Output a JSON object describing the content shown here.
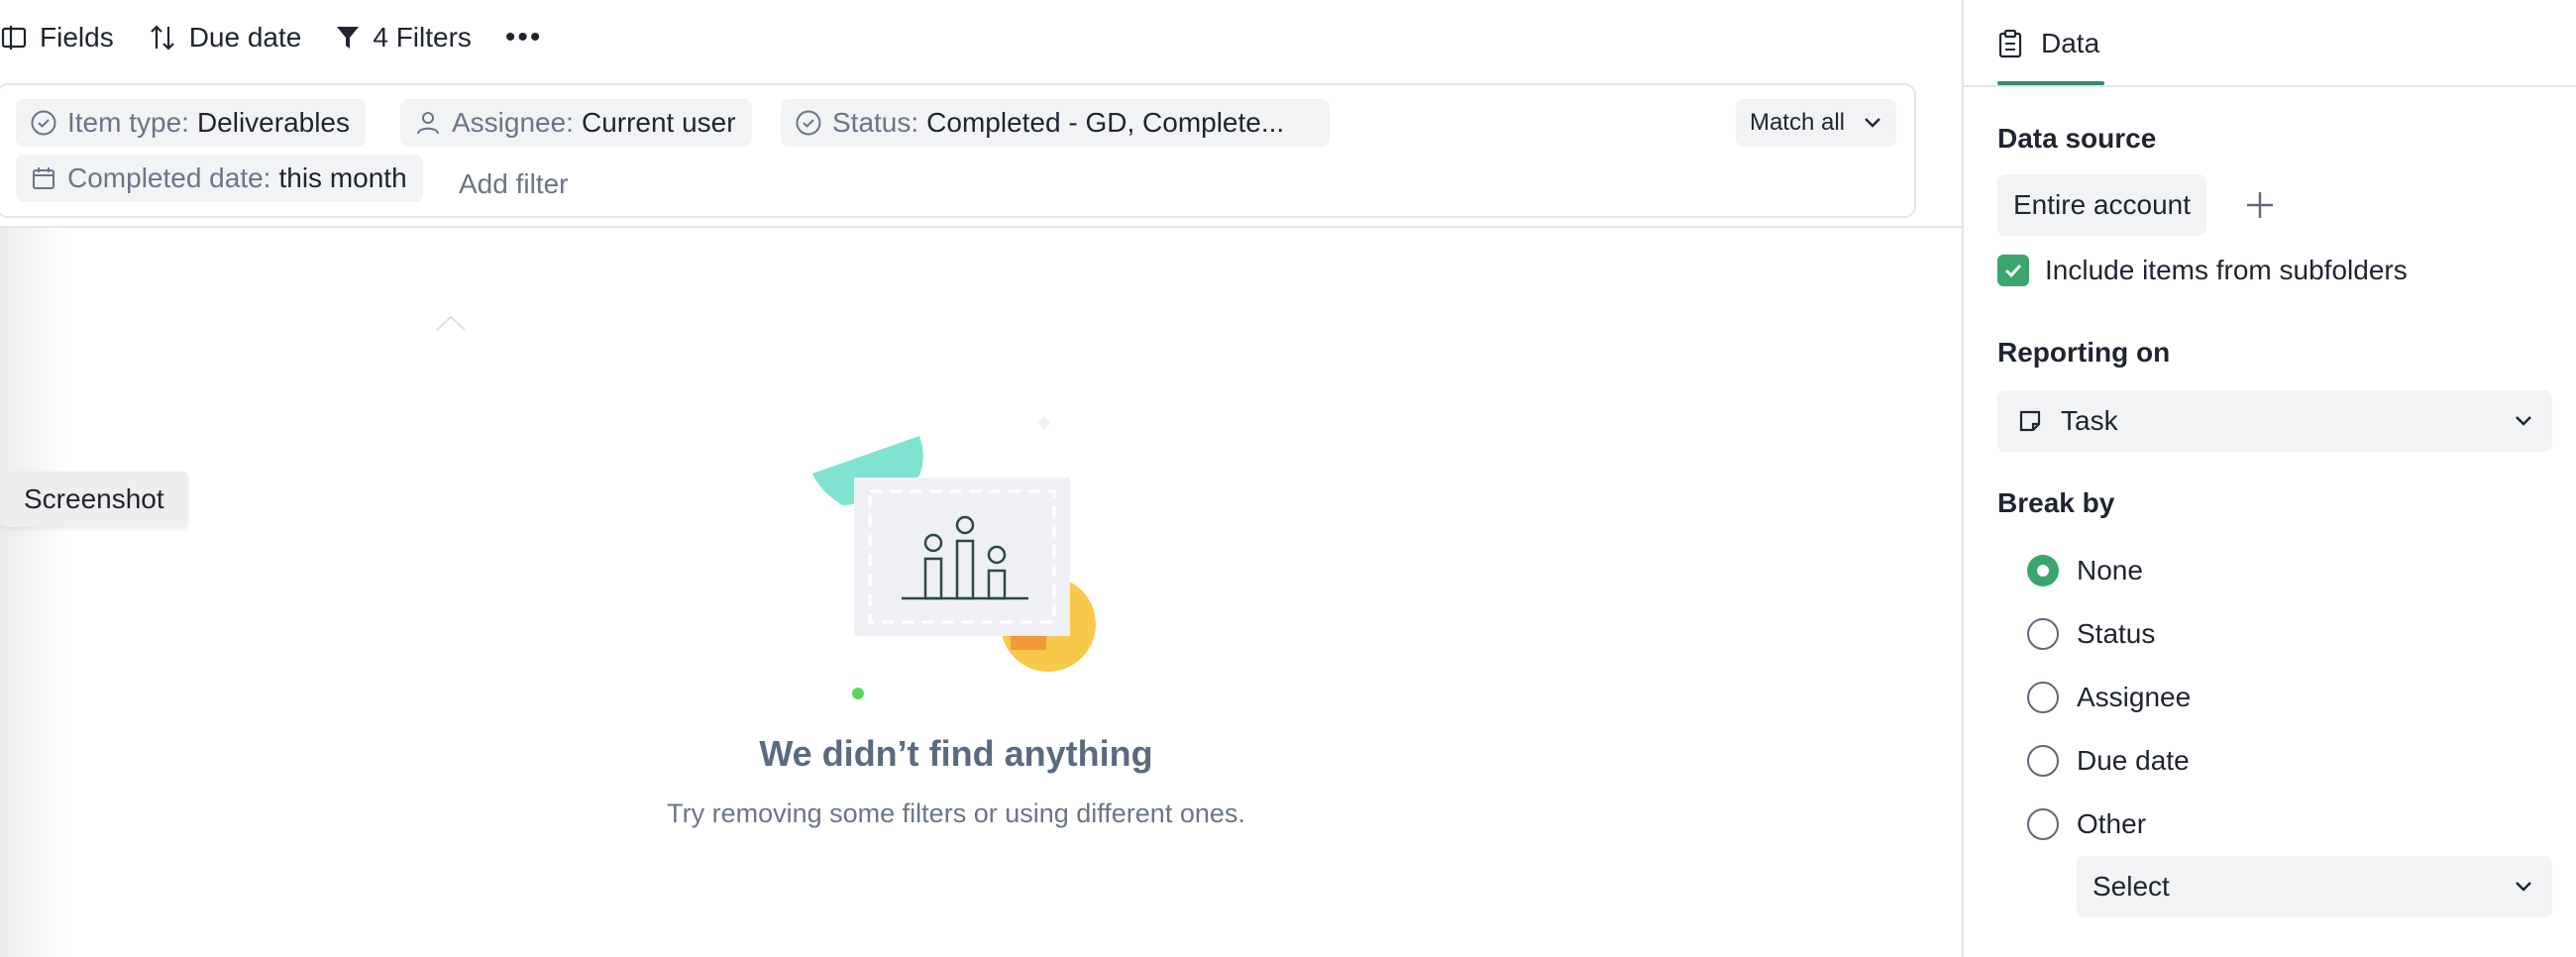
{
  "toolbar": {
    "fields_label": "Fields",
    "due_date_label": "Due date",
    "filters_label": "4 Filters",
    "more_label": "•••"
  },
  "filters": {
    "chips": [
      {
        "key": "Item type:",
        "value": "Deliverables",
        "icon": "check-circle-icon"
      },
      {
        "key": "Assignee:",
        "value": "Current user",
        "icon": "person-icon"
      },
      {
        "key": "Status:",
        "value": "Completed - GD, Complete...",
        "icon": "check-circle-icon"
      },
      {
        "key": "Completed date:",
        "value": "this month",
        "icon": "calendar-icon"
      }
    ],
    "match_label": "Match all",
    "add_filter_label": "Add filter"
  },
  "tooltip": {
    "label": "Screenshot"
  },
  "empty_state": {
    "title": "We didn’t find anything",
    "subtitle": "Try removing some filters or using different ones."
  },
  "panel": {
    "tab_label": "Data",
    "data_source": {
      "heading": "Data source",
      "chip": "Entire account",
      "include_subfolders": "Include items from subfolders",
      "include_subfolders_checked": true
    },
    "reporting_on": {
      "heading": "Reporting on",
      "value": "Task"
    },
    "break_by": {
      "heading": "Break by",
      "options": [
        {
          "label": "None",
          "selected": true
        },
        {
          "label": "Status",
          "selected": false
        },
        {
          "label": "Assignee",
          "selected": false
        },
        {
          "label": "Due date",
          "selected": false
        },
        {
          "label": "Other",
          "selected": false
        }
      ],
      "other_select": "Select"
    }
  },
  "colors": {
    "accent_green": "#3aa66e",
    "tab_underline": "#2f8f6a",
    "muted_text": "#6b7587",
    "chip_bg": "#f2f3f5"
  }
}
